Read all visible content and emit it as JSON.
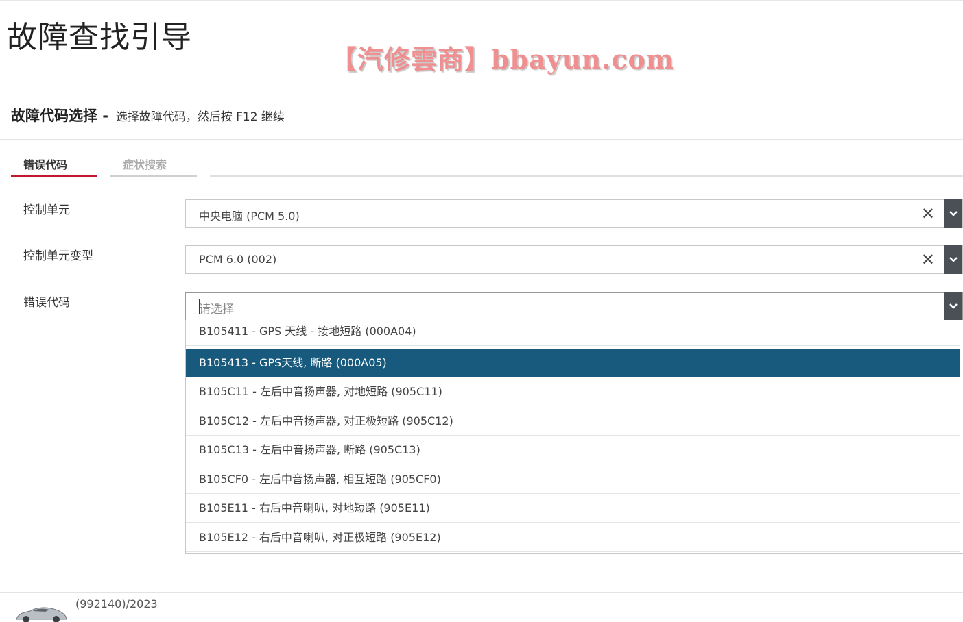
{
  "page": {
    "title": "故障查找引导",
    "watermark": "【汽修雲商】bbayun.com"
  },
  "step": {
    "title": "故障代码选择 -",
    "description": "选择故障代码，然后按 F12 继续"
  },
  "tabs": [
    {
      "label": "错误代码",
      "active": true
    },
    {
      "label": "症状搜索",
      "active": false
    }
  ],
  "form": {
    "control_unit": {
      "label": "控制单元",
      "value": "中央电脑 (PCM 5.0)"
    },
    "control_unit_variant": {
      "label": "控制单元变型",
      "value": "PCM 6.0 (002)"
    },
    "error_code": {
      "label": "错误代码",
      "placeholder": "请选择"
    }
  },
  "dropdown": {
    "options": [
      {
        "label": "B105411 - GPS 天线 - 接地短路 (000A04)",
        "selected": false
      },
      {
        "label": "B105413 - GPS天线, 断路 (000A05)",
        "selected": true
      },
      {
        "label": "B105C11 - 左后中音扬声器, 对地短路 (905C11)",
        "selected": false
      },
      {
        "label": "B105C12 - 左后中音扬声器, 对正极短路 (905C12)",
        "selected": false
      },
      {
        "label": "B105C13 - 左后中音扬声器, 断路 (905C13)",
        "selected": false
      },
      {
        "label": "B105CF0 - 左后中音扬声器, 相互短路 (905CF0)",
        "selected": false
      },
      {
        "label": "B105E11 - 右后中音喇叭, 对地短路 (905E11)",
        "selected": false
      },
      {
        "label": "B105E12 - 右后中音喇叭, 对正极短路 (905E12)",
        "selected": false
      }
    ]
  },
  "vehicle": {
    "model_text": "(992140)/2023",
    "icon": "car-icon"
  },
  "colors": {
    "accent_red": "#c0182c",
    "selected_bg": "#185a7d",
    "dropdown_button": "#4a5055"
  }
}
